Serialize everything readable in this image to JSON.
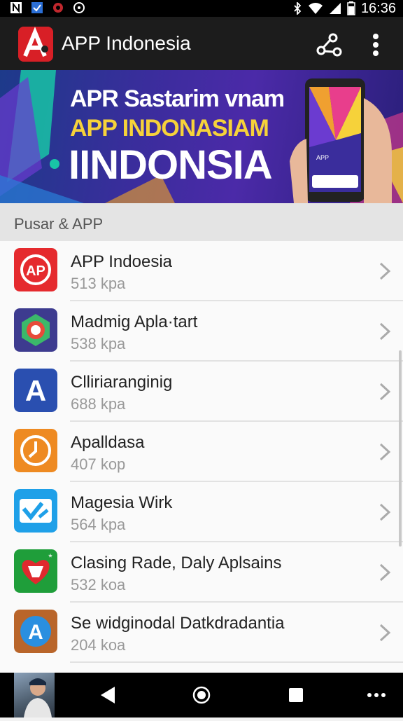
{
  "status_bar": {
    "time": "16:36",
    "icons": [
      "notification-n-icon",
      "download-check-icon",
      "app-notification-icon",
      "sync-icon",
      "bluetooth-icon",
      "wifi-icon",
      "signal-icon",
      "battery-icon"
    ]
  },
  "app_bar": {
    "title": "APP Indonesia",
    "icons": [
      "app-logo",
      "share-icon",
      "more-vert-icon"
    ],
    "accent": "#d81f26"
  },
  "banner": {
    "line1": "APR Sastarim vnam",
    "line2": "APP INDONASIAM",
    "line3": "IINDONSIA",
    "phone_text_line1": "APP"
  },
  "section": {
    "title": "Pusar & APP"
  },
  "apps": [
    {
      "name": "APP Indoesia",
      "size": "513 kpa",
      "icon": "ap-logo-icon",
      "color": "#e52a2e"
    },
    {
      "name": "Madmig Apla·tart",
      "size": "538 kpa",
      "icon": "aperture-icon",
      "color": "#3d3b8f"
    },
    {
      "name": "Clliriaranginig",
      "size": "688 kpa",
      "icon": "letter-a-icon",
      "color": "#2a4fb0"
    },
    {
      "name": "Apalldasa",
      "size": "407 kop",
      "icon": "clock-icon",
      "color": "#ee8a22"
    },
    {
      "name": "Magesia Wirk",
      "size": "564 kpa",
      "icon": "check-arrows-icon",
      "color": "#1fa0e8"
    },
    {
      "name": "Clasing Rade, Daly Aplsains",
      "size": "532 koa",
      "icon": "heart-map-icon",
      "color": "#1f9e3a"
    },
    {
      "name": "Se widginodal Datkdradantia",
      "size": "204 koa",
      "icon": "letter-a-circle-icon",
      "color": "#b9652a"
    }
  ],
  "nav_bar": {
    "icons": [
      "user-thumbnail",
      "back-icon",
      "home-icon",
      "recents-icon",
      "more-horiz-icon"
    ]
  }
}
